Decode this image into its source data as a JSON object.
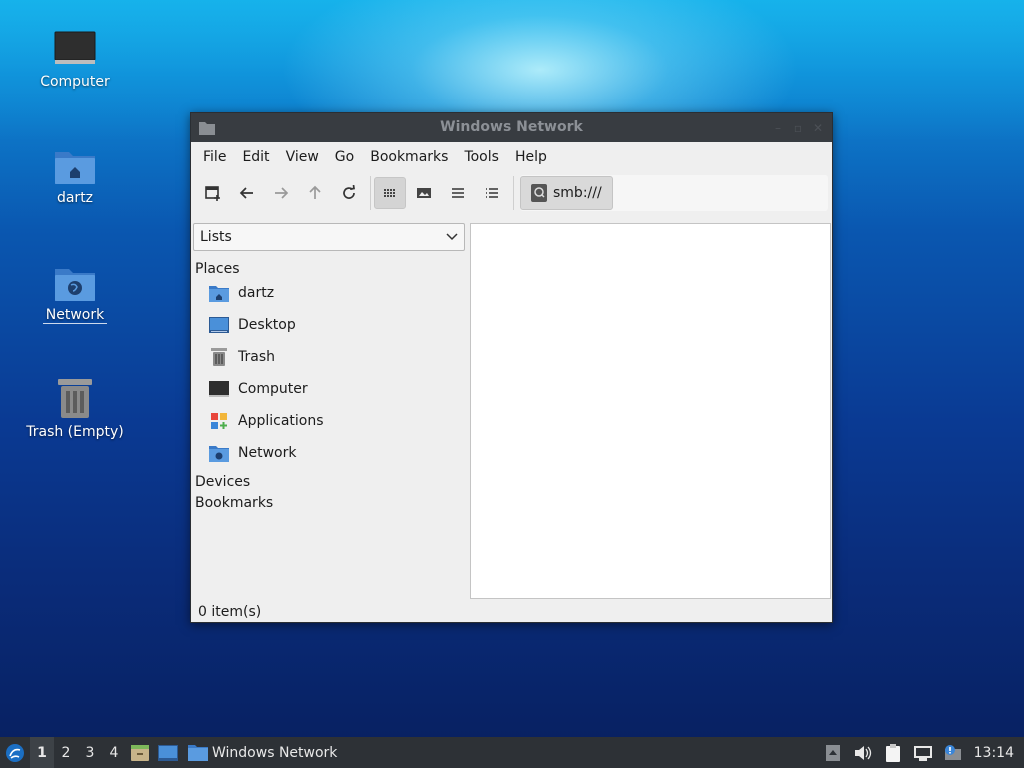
{
  "desktop": {
    "icons": [
      {
        "label": "Computer"
      },
      {
        "label": "dartz"
      },
      {
        "label": "Network"
      },
      {
        "label": "Trash (Empty)"
      }
    ]
  },
  "window": {
    "title": "Windows Network",
    "menu": [
      "File",
      "Edit",
      "View",
      "Go",
      "Bookmarks",
      "Tools",
      "Help"
    ],
    "path": "smb:///",
    "side_pane_mode": "Lists",
    "sections": {
      "places": "Places",
      "devices": "Devices",
      "bookmarks": "Bookmarks"
    },
    "places": [
      {
        "label": "dartz",
        "icon": "home-folder-icon"
      },
      {
        "label": "Desktop",
        "icon": "desktop-icon"
      },
      {
        "label": "Trash",
        "icon": "trash-icon"
      },
      {
        "label": "Computer",
        "icon": "computer-icon"
      },
      {
        "label": "Applications",
        "icon": "applications-icon"
      },
      {
        "label": "Network",
        "icon": "network-folder-icon"
      }
    ],
    "status": "0 item(s)"
  },
  "taskbar": {
    "workspaces": [
      "1",
      "2",
      "3",
      "4"
    ],
    "active_workspace": "1",
    "task_label": "Windows Network",
    "clock": "13:14"
  },
  "colors": {
    "folder_blue": "#4a90d9",
    "titlebar": "#383c41",
    "taskbar": "#2d3136"
  }
}
